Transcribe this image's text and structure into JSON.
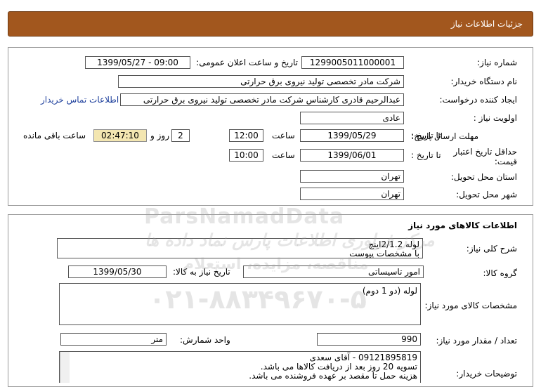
{
  "header": {
    "title": "جزئیات اطلاعات نیاز"
  },
  "info": {
    "need_number_label": "شماره نیاز:",
    "need_number": "1299005011000001",
    "announce_label": "تاریخ و ساعت اعلان عمومی:",
    "announce_value": "1399/05/27 - 09:00",
    "buyer_org_label": "نام دستگاه خریدار:",
    "buyer_org": "شرکت مادر تخصصی تولید نیروی برق حرارتی",
    "requester_label": "ایجاد کننده درخواست:",
    "requester": "عبدالرحیم قادری کارشناس شرکت مادر تخصصی تولید نیروی برق حرارتی",
    "contact_link": "اطلاعات تماس خریدار",
    "priority_label": "اولویت نیاز :",
    "priority": "عادی",
    "deadline_label": "مهلت ارسال پاسخ:",
    "to_date_label": "تا تاریخ :",
    "deadline_date": "1399/05/29",
    "time_label": "ساعت",
    "deadline_time": "12:00",
    "days_value": "2",
    "days_label": "روز و",
    "remaining_time": "02:47:10",
    "remaining_label": "ساعت باقی مانده",
    "validity_label_1": "حداقل تاریخ اعتبار",
    "validity_label_2": "قیمت:",
    "validity_date": "1399/06/01",
    "validity_time": "10:00",
    "province_label": "استان محل تحویل:",
    "province": "تهران",
    "city_label": "شهر محل تحویل:",
    "city": "تهران"
  },
  "goods": {
    "section_title": "اطلاعات کالاهای مورد نیاز",
    "description_label": "شرح کلی نیاز:",
    "description_line1": "لوله 2/1.2اینچ",
    "description_line2": "با مشخصات پیوست",
    "group_label": "گروه کالا:",
    "group_value": "امور تاسیساتی",
    "need_date_label": "تاریخ نیاز به کالا:",
    "need_date": "1399/05/30",
    "specs_label": "مشخصات کالای مورد نیاز:",
    "specs_value": "لوله (دو 1 دوم)",
    "quantity_label": "تعداد / مقدار مورد نیاز:",
    "quantity": "990",
    "unit_label": "واحد شمارش:",
    "unit": "متر",
    "buyer_notes_label": "توضیحات خریدار:",
    "buyer_notes_line1": "09121895819 - آقای سعدی",
    "buyer_notes_line2": "تسویه 20 روز بعد از دریافت کالاها می باشد.",
    "buyer_notes_line3": "هزینه حمل تا مقصد بر عهده فروشنده می باشد."
  },
  "watermark": {
    "brand": "ParsNamadData",
    "line1": "مرکز فراوری اطلاعات پارس نماد داده ها",
    "line2": "مناقصه، مزایده، استعلام",
    "phone": "۰۲۱-۸۸۳۴۹۶۷۰-۵"
  }
}
